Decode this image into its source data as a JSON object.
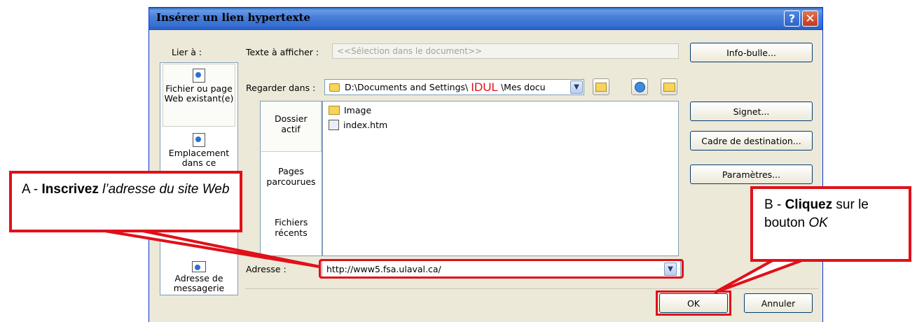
{
  "window": {
    "title": "Insérer un lien hypertexte",
    "help_glyph": "?",
    "close_glyph": "✕"
  },
  "link_to": {
    "label": "Lier à :",
    "items": [
      {
        "label": "Fichier ou page Web existant(e)",
        "icon": "web-page-icon"
      },
      {
        "label": "Emplacement dans ce",
        "icon": "document-place-icon"
      },
      {
        "label": "Adresse de messagerie",
        "icon": "email-icon"
      }
    ]
  },
  "display_text": {
    "label": "Texte à afficher :",
    "value": "<<Sélection dans le document>>"
  },
  "look_in": {
    "label": "Regarder dans :",
    "path_prefix": "D:\\Documents and Settings\\ ",
    "path_highlight": "IDUL",
    "path_suffix": " \\Mes docu"
  },
  "places": {
    "current": "Dossier actif",
    "browsed": "Pages parcourues",
    "recent": "Fichiers récents"
  },
  "files": [
    {
      "name": "Image",
      "icon": "folder-icon"
    },
    {
      "name": "index.htm",
      "icon": "html-file-icon"
    }
  ],
  "address": {
    "label": "Adresse :",
    "value": "http://www5.fsa.ulaval.ca/"
  },
  "buttons": {
    "screentip": "Info-bulle...",
    "bookmark": "Signet...",
    "target_frame": "Cadre de destination...",
    "params": "Paramètres...",
    "ok": "OK",
    "cancel": "Annuler"
  },
  "callout_a": {
    "prefix": "A - ",
    "bold": "Inscrivez",
    "italic": "l’adresse du site Web"
  },
  "callout_b": {
    "prefix": "B - ",
    "bold": "Cliquez",
    "text": " sur le bouton ",
    "italic": "OK"
  },
  "colors": {
    "highlight_red": "#e0101a",
    "title_blue": "#356fd2",
    "dialog_bg": "#ece9d8"
  }
}
